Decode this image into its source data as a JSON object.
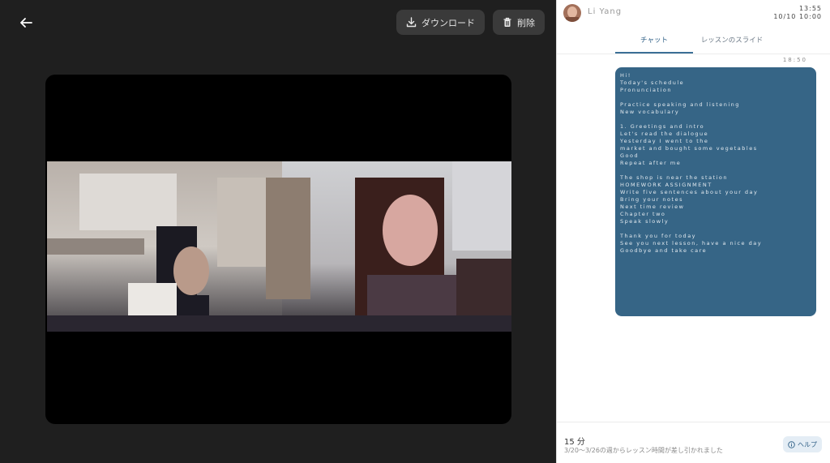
{
  "toolbar": {
    "back_icon": "arrow-left-icon",
    "download_label": "ダウンロード",
    "download_icon": "download-icon",
    "delete_label": "削除",
    "delete_icon": "trash-icon"
  },
  "profile": {
    "name": "Li Yang",
    "meta_line1": "13:55 ",
    "meta_line2": "10/10 10:00"
  },
  "tabs": [
    {
      "label": "チャット",
      "active": true
    },
    {
      "label": "レッスンのスライド",
      "active": false
    }
  ],
  "chat": {
    "message_time": "18:50",
    "lines": [
      "Hi!",
      "Today's schedule",
      "Pronunciation",
      "",
      "Practice speaking and listening",
      "New vocabulary",
      "",
      "1. Greetings and intro",
      "Let's read the dialogue",
      "Yesterday I went to the",
      "market and bought some vegetables",
      "Good",
      "Repeat after me",
      "",
      "The shop is near the station",
      "HOMEWORK ASSIGNMENT",
      "Write five sentences about your day",
      "Bring your notes",
      "Next time review",
      "Chapter two",
      "Speak slowly",
      "",
      "Thank you for today",
      "See you next lesson, have a nice day",
      "Goodbye and take care"
    ],
    "colors": {
      "bubble": "#366586",
      "accent": "#3b6f96"
    }
  },
  "footer": {
    "duration": "15 分",
    "note": "3/20〜3/26の週からレッスン時間が差し引かれました",
    "help_label": "ヘルプ",
    "help_icon": "info-icon"
  },
  "theme": {
    "player_bg": "#1f1f1f",
    "button_bg": "#3a3a3a"
  }
}
